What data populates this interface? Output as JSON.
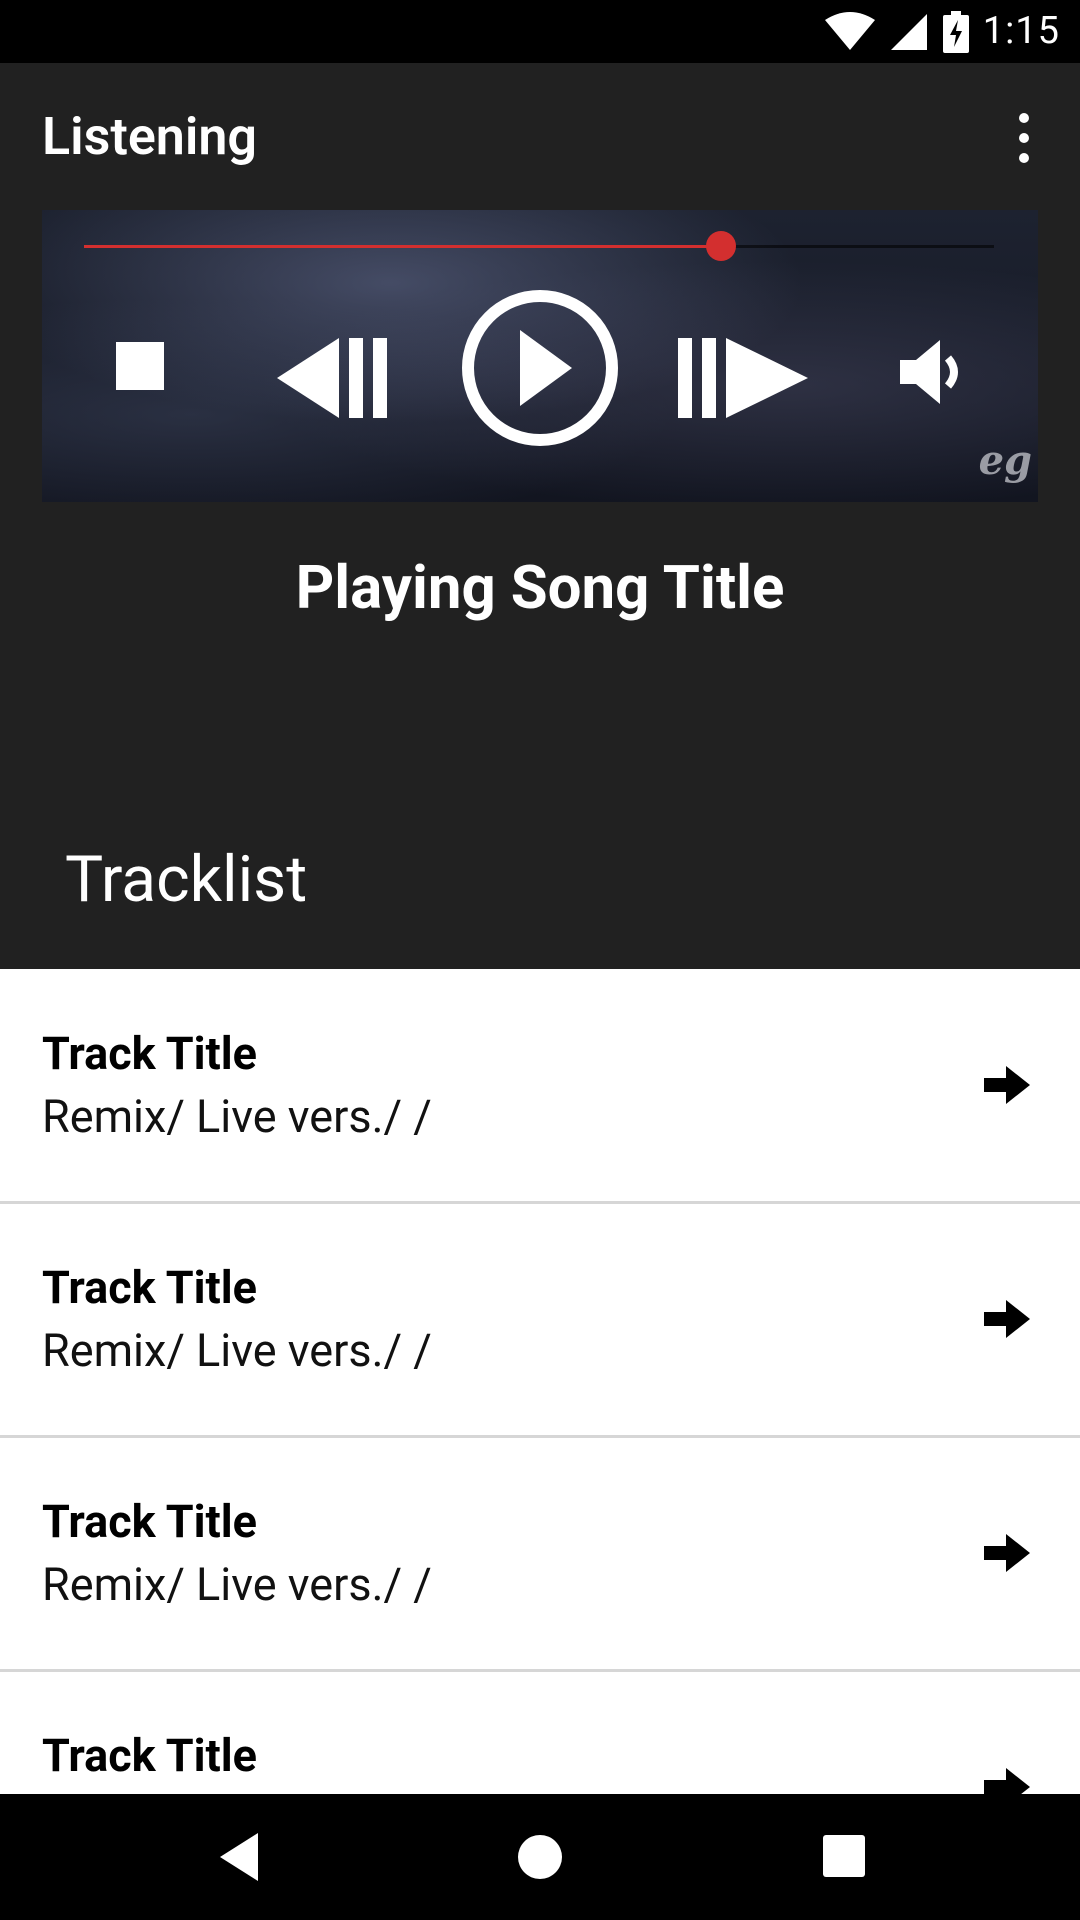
{
  "status": {
    "time": "1:15"
  },
  "appbar": {
    "title": "Listening"
  },
  "player": {
    "progress": 0.7,
    "watermark": "eg",
    "accent": "#d32f2f"
  },
  "now_playing": {
    "title": "Playing Song Title"
  },
  "tracklist": {
    "heading": "Tracklist",
    "items": [
      {
        "title": "Track Title",
        "subtitle": "Remix/ Live vers./ /"
      },
      {
        "title": "Track Title",
        "subtitle": "Remix/ Live vers./ /"
      },
      {
        "title": "Track Title",
        "subtitle": "Remix/ Live vers./ /"
      },
      {
        "title": "Track Title",
        "subtitle": ""
      }
    ]
  },
  "icons": {
    "status": [
      "wifi-icon",
      "cell-signal-icon",
      "battery-charging-icon"
    ],
    "appbar": "more-vert-icon",
    "player": [
      "stop-icon",
      "previous-icon",
      "play-icon",
      "next-icon",
      "volume-icon"
    ],
    "row": "arrow-right-icon",
    "nav": [
      "back-icon",
      "home-icon",
      "recents-icon"
    ]
  }
}
